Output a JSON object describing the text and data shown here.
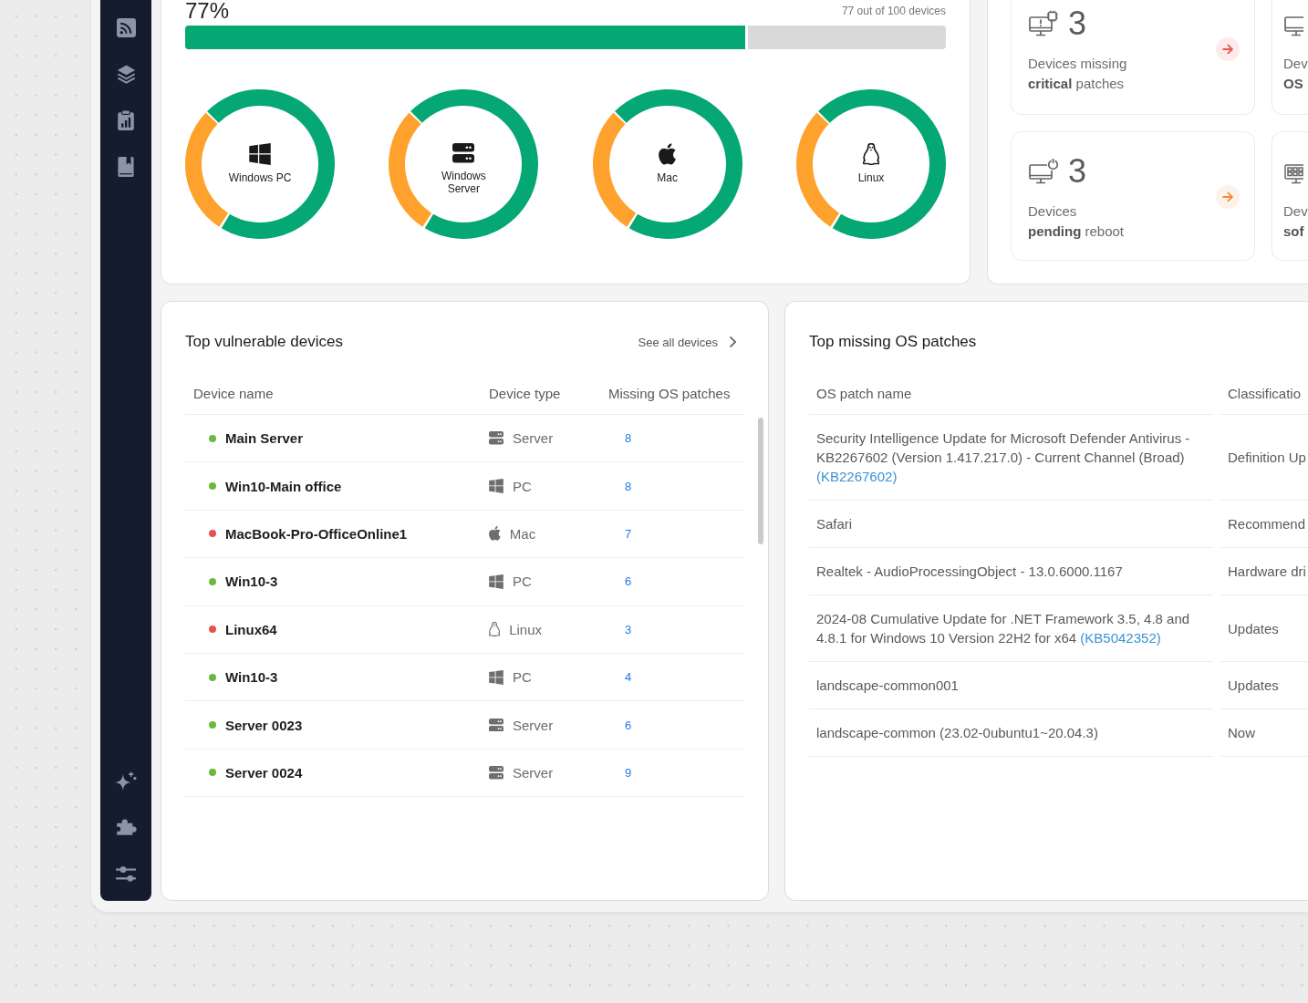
{
  "overview": {
    "percent": "77%",
    "summary": "77 out of 100 devices",
    "progress": {
      "level": 0.74
    },
    "platforms": [
      {
        "kind": "windows",
        "label": "Windows PC"
      },
      {
        "kind": "server",
        "label": "Windows Server"
      },
      {
        "kind": "apple",
        "label": "Mac"
      },
      {
        "kind": "linux",
        "label": "Linux"
      }
    ]
  },
  "stat_cards": [
    {
      "kind": "alert",
      "count": "3",
      "title": "Devices missing",
      "detail": "**critical** patches",
      "color": "#fcebea"
    },
    {
      "kind": "plain",
      "title": "Dev",
      "detail": "**OS**"
    },
    {
      "kind": "power",
      "count": "3",
      "title": "Devices",
      "detail": "**pending** reboot",
      "color": "#fdf1e8"
    },
    {
      "kind": "grid",
      "title": "Dev",
      "detail": "**sof**"
    }
  ],
  "vulnerable_devices": {
    "title": "Top vulnerable devices",
    "link": "See all devices",
    "columns": [
      "Device name",
      "Device type",
      "Missing OS patches"
    ],
    "rows": [
      {
        "name": "Main Server",
        "color": "#6cb840",
        "kind": "server",
        "type": "Server",
        "missing": "8"
      },
      {
        "name": "Win10-Main office",
        "color": "#6cb840",
        "kind": "windows",
        "type": "PC",
        "missing": "8"
      },
      {
        "name": "MacBook-Pro-OfficeOnline1",
        "color": "#e55350",
        "kind": "apple",
        "type": "Mac",
        "missing": "7"
      },
      {
        "name": "Win10-3",
        "color": "#6cb840",
        "kind": "windows",
        "type": "PC",
        "missing": "6"
      },
      {
        "name": "Linux64",
        "color": "#e55350",
        "kind": "linux",
        "type": "Linux",
        "missing": "3"
      },
      {
        "name": "Win10-3",
        "color": "#6cb840",
        "kind": "windows",
        "type": "PC",
        "missing": "4"
      },
      {
        "name": "Server 0023",
        "color": "#6cb840",
        "kind": "server",
        "type": "Server",
        "missing": "6"
      },
      {
        "name": "Server 0024",
        "color": "#6cb840",
        "kind": "server",
        "type": "Server",
        "missing": "9"
      }
    ]
  },
  "missing_patches": {
    "title": "Top missing OS patches",
    "columns": [
      "OS patch name",
      "Classificatio"
    ],
    "rows": [
      {
        "name": "Security Intelligence Update for Microsoft Defender Antivirus - KB2267602 (Version 1.417.217.0) - Current Channel (Broad)",
        "link": "(KB2267602)",
        "classification": "Definition Up"
      },
      {
        "name": "Safari",
        "classification": "Recommend"
      },
      {
        "name": "Realtek - AudioProcessingObject - 13.0.6000.1167",
        "classification": "Hardware dri"
      },
      {
        "name": "2024-08 Cumulative Update for .NET Framework 3.5, 4.8 and 4.8.1 for Windows 10 Version 22H2 for x64",
        "link": "(KB5042352)",
        "classification": "Updates"
      },
      {
        "name": "landscape-common001",
        "classification": "Updates"
      },
      {
        "name": "landscape-common (23.02-0ubuntu1~20.04.3)",
        "classification": "Now"
      }
    ]
  }
}
